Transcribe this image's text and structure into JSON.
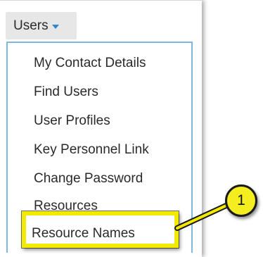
{
  "users_menu": {
    "toggle_label": "Users",
    "items": [
      {
        "label": "My Contact Details"
      },
      {
        "label": "Find Users"
      },
      {
        "label": "User Profiles"
      },
      {
        "label": "Key Personnel Link"
      },
      {
        "label": "Change Password"
      },
      {
        "label": "Resources"
      },
      {
        "label": "Resource Names"
      }
    ],
    "highlighted_index": 6
  },
  "callout": {
    "number": "1"
  },
  "colors": {
    "caret": "#2f86c8",
    "menu_border": "#7fb9e0",
    "highlight_border": "#f2ea00",
    "callout_fill": "#f4ee20"
  },
  "icons": {
    "dropdown_caret": "caret-down-icon"
  }
}
